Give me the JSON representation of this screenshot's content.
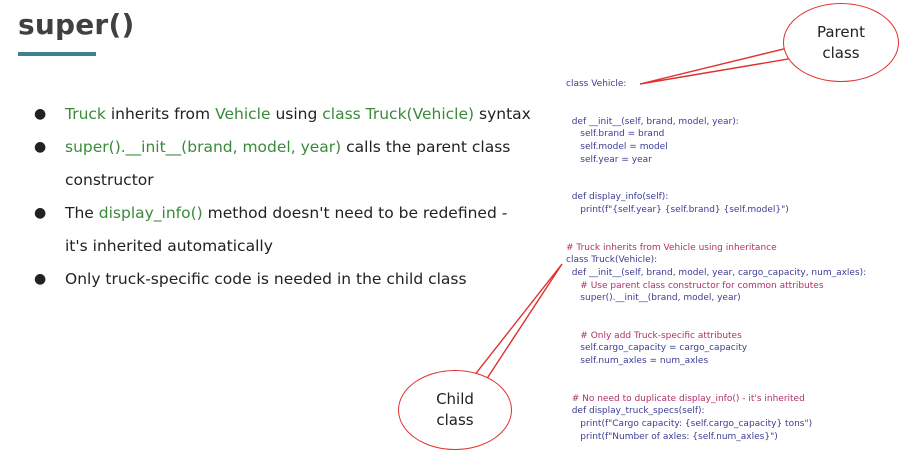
{
  "title": "super()",
  "bullets": [
    {
      "parts": [
        {
          "text": "Truck",
          "green": true
        },
        {
          "text": " inherits from ",
          "green": false
        },
        {
          "text": "Vehicle",
          "green": true
        },
        {
          "text": " using ",
          "green": false
        },
        {
          "text": "class Truck(Vehicle)",
          "green": true
        },
        {
          "text": " syntax",
          "green": false
        }
      ]
    },
    {
      "parts": [
        {
          "text": "super().__init__(brand, model, year)",
          "green": true
        },
        {
          "text": " calls the parent class constructor",
          "green": false
        }
      ]
    },
    {
      "parts": [
        {
          "text": "The ",
          "green": false
        },
        {
          "text": "display_info()",
          "green": true
        },
        {
          "text": " method doesn't need to be redefined - it's inherited automatically",
          "green": false
        }
      ]
    },
    {
      "parts": [
        {
          "text": "Only truck-specific code is needed in the child class",
          "green": false
        }
      ]
    }
  ],
  "code_lines": [
    {
      "text": "class Vehicle:",
      "type": "code"
    },
    {
      "text": "",
      "type": "code"
    },
    {
      "text": "",
      "type": "code"
    },
    {
      "text": "  def __init__(self, brand, model, year):",
      "type": "code"
    },
    {
      "text": "     self.brand = brand",
      "type": "code"
    },
    {
      "text": "     self.model = model",
      "type": "code"
    },
    {
      "text": "     self.year = year",
      "type": "code"
    },
    {
      "text": "",
      "type": "code"
    },
    {
      "text": "",
      "type": "code"
    },
    {
      "text": "  def display_info(self):",
      "type": "code"
    },
    {
      "text": "     print(f\"{self.year} {self.brand} {self.model}\")",
      "type": "code"
    },
    {
      "text": "",
      "type": "code"
    },
    {
      "text": "",
      "type": "code"
    },
    {
      "text": "# Truck inherits from Vehicle using inheritance",
      "type": "comment"
    },
    {
      "text": "class Truck(Vehicle):",
      "type": "code"
    },
    {
      "text": "  def __init__(self, brand, model, year, cargo_capacity, num_axles):",
      "type": "code"
    },
    {
      "text": "     # Use parent class constructor for common attributes",
      "type": "comment"
    },
    {
      "text": "     super().__init__(brand, model, year)",
      "type": "code"
    },
    {
      "text": "",
      "type": "code"
    },
    {
      "text": "",
      "type": "code"
    },
    {
      "text": "     # Only add Truck-specific attributes",
      "type": "comment"
    },
    {
      "text": "     self.cargo_capacity = cargo_capacity",
      "type": "code"
    },
    {
      "text": "     self.num_axles = num_axles",
      "type": "code"
    },
    {
      "text": "",
      "type": "code"
    },
    {
      "text": "",
      "type": "code"
    },
    {
      "text": "  # No need to duplicate display_info() - it's inherited",
      "type": "comment"
    },
    {
      "text": "  def display_truck_specs(self):",
      "type": "code"
    },
    {
      "text": "     print(f\"Cargo capacity: {self.cargo_capacity} tons\")",
      "type": "code"
    },
    {
      "text": "     print(f\"Number of axles: {self.num_axles}\")",
      "type": "code"
    }
  ],
  "callouts": {
    "parent": [
      "Parent",
      "class"
    ],
    "child": [
      "Child",
      "class"
    ]
  },
  "colors": {
    "accent_underline": "#3f7f8f",
    "highlight_green": "#3a8a3a",
    "code_blue": "#3c3c96",
    "comment_pink": "#b0306a",
    "callout_red": "#e03030"
  }
}
